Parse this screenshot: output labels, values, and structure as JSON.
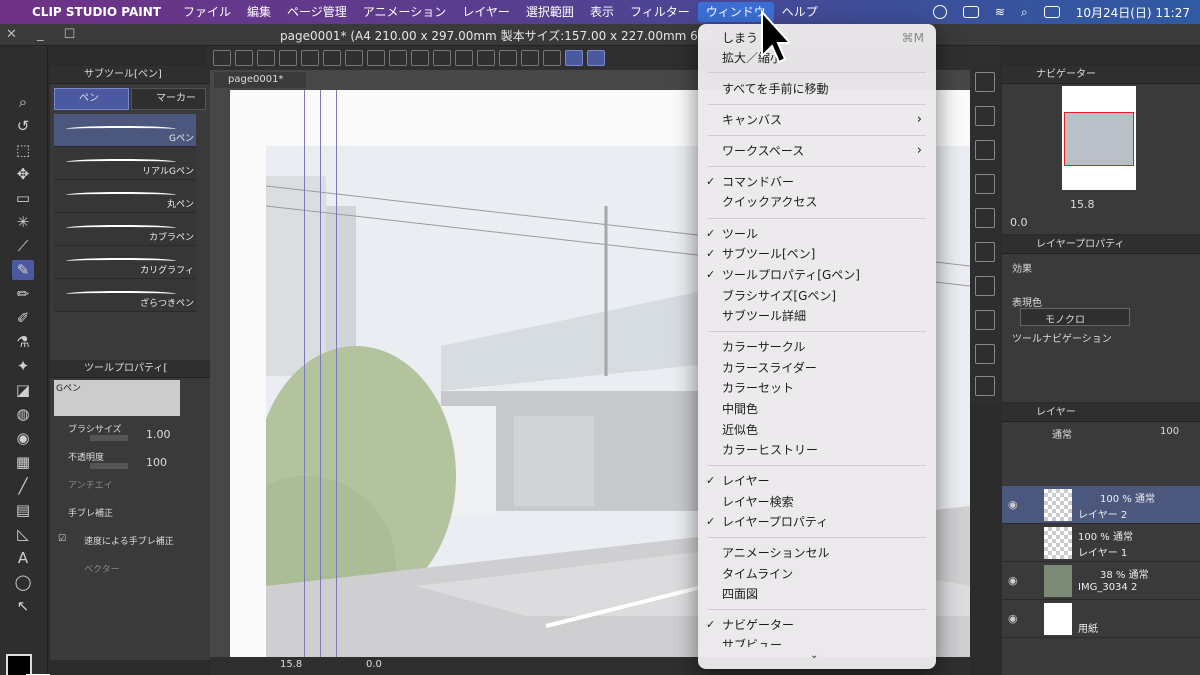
{
  "menubar": {
    "app_name": "CLIP STUDIO PAINT",
    "items": [
      "ファイル",
      "編集",
      "ページ管理",
      "アニメーション",
      "レイヤー",
      "選択範囲",
      "表示",
      "フィルター",
      "ウィンドウ",
      "ヘルプ"
    ],
    "active_item": "ウィンドウ",
    "clock": "10月24日(日)  11:27"
  },
  "titlebar": {
    "document": "page0001* (A4 210.00 x 297.00mm 製本サイズ:157.00 x 227.00mm 600"
  },
  "subtool_panel": {
    "title": "サブツール[ペン]",
    "tabs": [
      "ペン",
      "マーカー"
    ],
    "brushes": [
      "Gペン",
      "リアルGペン",
      "丸ペン",
      "カブラペン",
      "カリグラフィ",
      "ざらつきペン"
    ],
    "selected_brush": "Gペン"
  },
  "tool_property": {
    "title": "ツールプロパティ[",
    "preview_label": "Gペン",
    "brush_size_label": "ブラシサイズ",
    "brush_size_value": "1.00",
    "opacity_label": "不透明度",
    "opacity_value": "100",
    "antialias_label": "アンチエイ",
    "stabilize_label": "手ブレ補正",
    "speed_stabilize_label": "速度による手ブレ補正",
    "vector_label": "ベクター"
  },
  "canvas": {
    "tab_label": "page0001*",
    "zoom_value": "15.8",
    "rotation_value": "0.0"
  },
  "navigator": {
    "title": "ナビゲーター",
    "zoom": "15.8",
    "rotation": "0.0"
  },
  "layer_property": {
    "title": "レイヤープロパティ",
    "effect_label": "効果",
    "expression_color_label": "表現色",
    "expression_color_value": "モノクロ",
    "tool_nav_label": "ツールナビゲーション"
  },
  "layer_panel": {
    "title": "レイヤー",
    "blend_mode": "通常",
    "opacity": "100",
    "layers": [
      {
        "blend": "100 % 通常",
        "name": "レイヤー 2"
      },
      {
        "blend": "100 % 通常",
        "name": "レイヤー 1"
      },
      {
        "blend": "38 % 通常",
        "name": "IMG_3034 2"
      },
      {
        "blend": "",
        "name": "用紙"
      }
    ]
  },
  "window_menu": {
    "items": [
      {
        "label": "しまう",
        "shortcut": "⌘M",
        "check": false
      },
      {
        "label": "拡大／縮小",
        "check": false
      },
      {
        "label": "すべてを手前に移動",
        "check": false
      },
      {
        "label": "キャンバス",
        "submenu": true,
        "check": false
      },
      {
        "label": "ワークスペース",
        "submenu": true,
        "check": false
      },
      {
        "label": "コマンドバー",
        "check": true
      },
      {
        "label": "クイックアクセス",
        "check": false
      },
      {
        "label": "ツール",
        "check": true
      },
      {
        "label": "サブツール[ペン]",
        "check": true
      },
      {
        "label": "ツールプロパティ[Gペン]",
        "check": true
      },
      {
        "label": "ブラシサイズ[Gペン]",
        "check": false
      },
      {
        "label": "サブツール詳細",
        "check": false
      },
      {
        "label": "カラーサークル",
        "check": false
      },
      {
        "label": "カラースライダー",
        "check": false
      },
      {
        "label": "カラーセット",
        "check": false
      },
      {
        "label": "中間色",
        "check": false
      },
      {
        "label": "近似色",
        "check": false
      },
      {
        "label": "カラーヒストリー",
        "check": false
      },
      {
        "label": "レイヤー",
        "check": true
      },
      {
        "label": "レイヤー検索",
        "check": false
      },
      {
        "label": "レイヤープロパティ",
        "check": true
      },
      {
        "label": "アニメーションセル",
        "check": false
      },
      {
        "label": "タイムライン",
        "check": false
      },
      {
        "label": "四面図",
        "check": false
      },
      {
        "label": "ナビゲーター",
        "check": true
      },
      {
        "label": "サブビュー",
        "check": false
      }
    ],
    "checkmark": "✓",
    "submenu_arrow": "›",
    "scroll_more": "⌄"
  },
  "colors": {
    "accent_blue": "#3b6fd6",
    "selection": "#4b5aa0",
    "menu_bg": "#ece9ec"
  }
}
